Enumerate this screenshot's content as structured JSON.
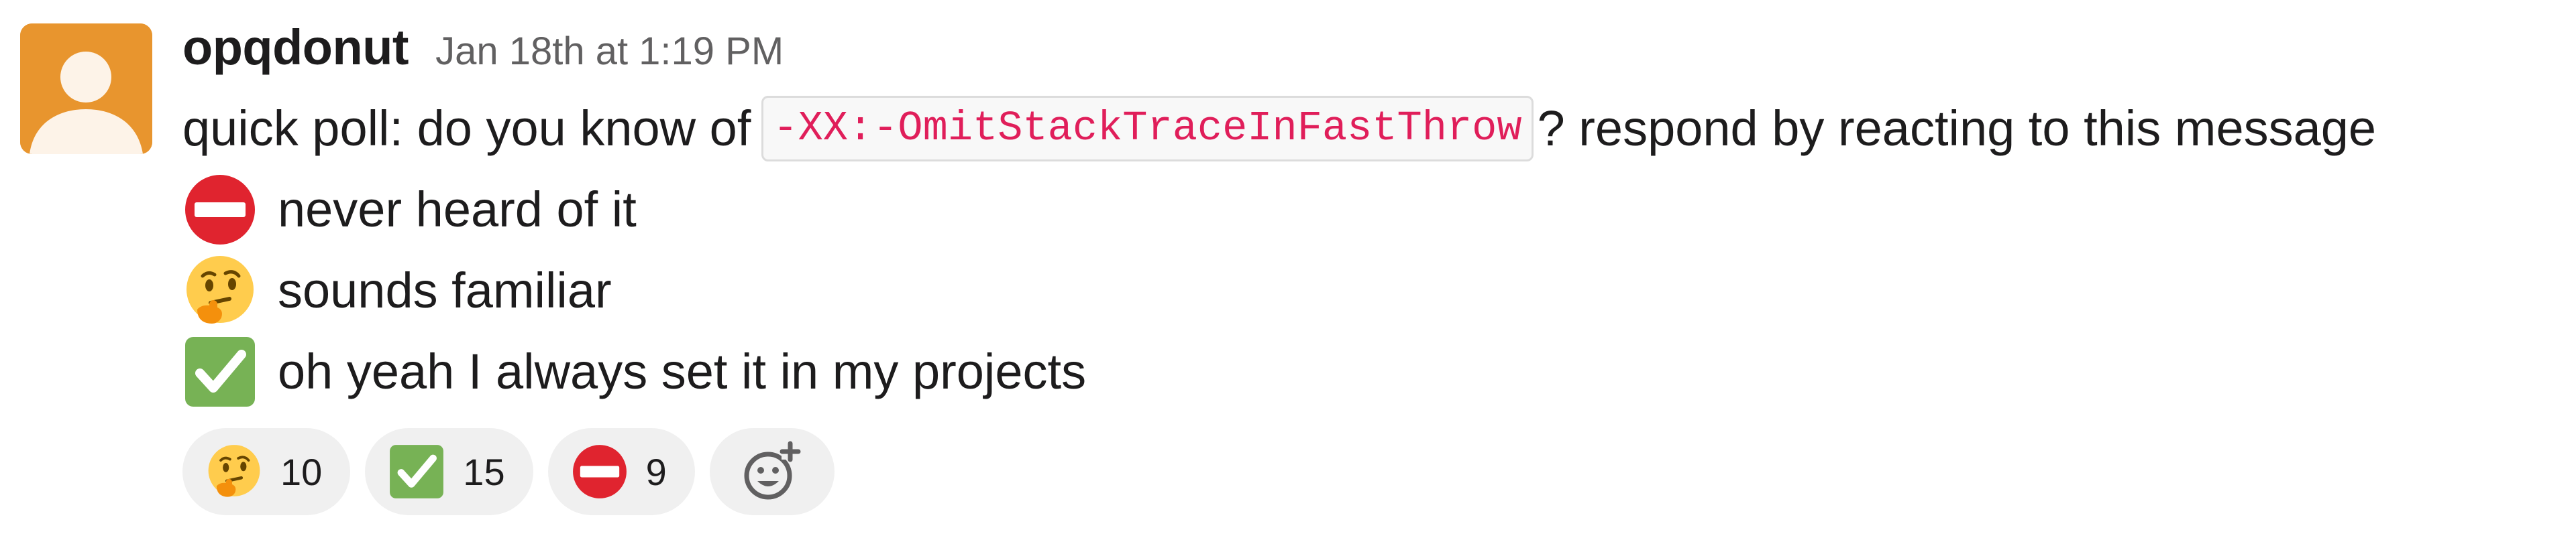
{
  "message": {
    "author": "opqdonut",
    "timestamp": "Jan 18th at 1:19 PM",
    "avatar": {
      "icon": "user-silhouette-icon",
      "color": "#e8952e"
    },
    "line1": {
      "prefix": "quick poll: do you know of",
      "code": "-XX:-OmitStackTraceInFastThrow",
      "suffix": "? respond by reacting to this message"
    },
    "options": [
      {
        "icon": "no-entry-icon",
        "text": "never heard of it"
      },
      {
        "icon": "thinking-face-icon",
        "text": "sounds familiar"
      },
      {
        "icon": "white-check-mark-icon",
        "text": "oh yeah I always set it in my projects"
      }
    ],
    "reactions": [
      {
        "icon": "thinking-face-icon",
        "count": "10"
      },
      {
        "icon": "white-check-mark-icon",
        "count": "15"
      },
      {
        "icon": "no-entry-icon",
        "count": "9"
      }
    ],
    "add_reaction": {
      "icon": "add-reaction-icon"
    }
  },
  "colors": {
    "author": "#1d1c1d",
    "timestamp": "#616061",
    "code_text": "#e01e5a",
    "code_bg": "#f8f8f8",
    "reaction_bg": "#f0f0f0"
  }
}
